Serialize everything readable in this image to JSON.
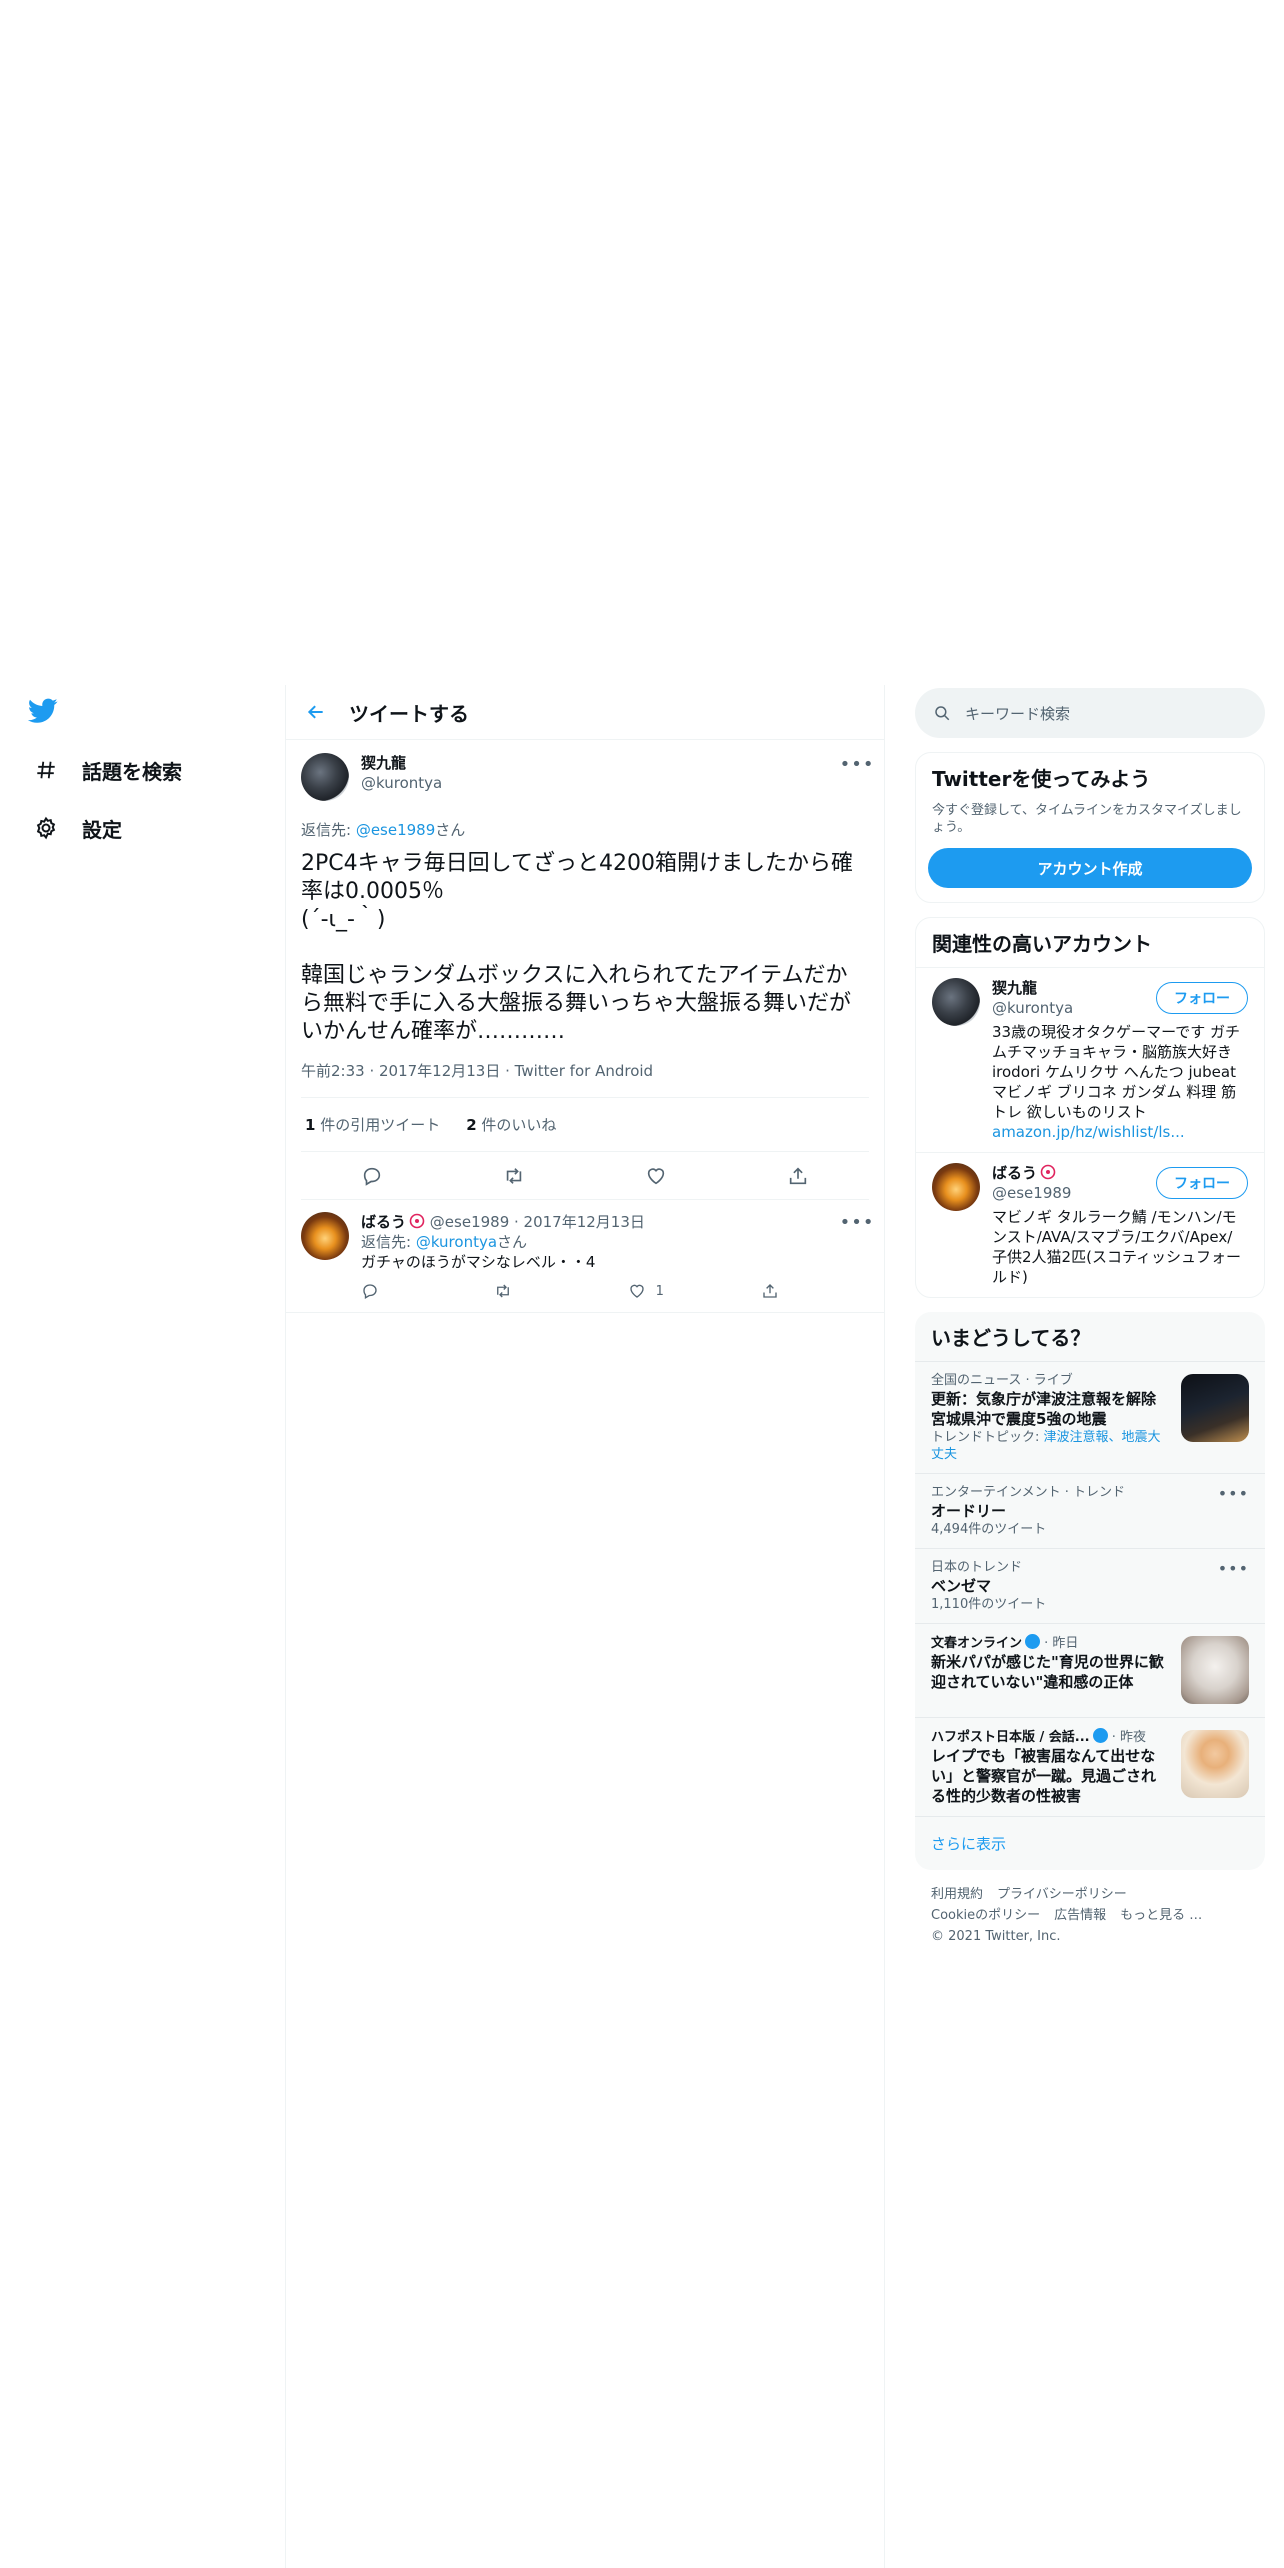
{
  "nav": {
    "items": [
      {
        "label": "話題を検索",
        "icon": "hashtag-icon"
      },
      {
        "label": "設定",
        "icon": "gear-icon"
      }
    ]
  },
  "header": {
    "title": "ツイートする"
  },
  "tweet": {
    "author_name": "猰九龍",
    "author_handle": "@kurontya",
    "replying_prefix": "返信先: ",
    "replying_handle": "@ese1989",
    "replying_suffix": "さん",
    "text": "2PC4キャラ毎日回してざっと4200箱開けましたから確率は0.0005％\n(´-ι_-｀)\n\n韓国じゃランダムボックスに入れられてたアイテムだから無料で手に入る大盤振る舞いっちゃ大盤振る舞いだがいかんせん確率が…………",
    "meta": "午前2:33 · 2017年12月13日 · Twitter for Android",
    "quote_count": "1",
    "quote_label": " 件の引用ツイート",
    "like_count": "2",
    "like_label": " 件のいいね"
  },
  "reply": {
    "name": "ばるう",
    "handle_date": "@ese1989 · 2017年12月13日",
    "replying_prefix": "返信先: ",
    "replying_handle": "@kurontya",
    "replying_suffix": "さん",
    "text": "ガチャのほうがマシなレベル・・4",
    "like_count": "1"
  },
  "search": {
    "placeholder": "キーワード検索"
  },
  "signup": {
    "title": "Twitterを使ってみよう",
    "subtitle": "今すぐ登録して、タイムラインをカスタマイズしましょう。",
    "button": "アカウント作成"
  },
  "related": {
    "title": "関連性の高いアカウント",
    "accounts": [
      {
        "name": "猰九龍",
        "handle": "@kurontya",
        "bio": "33歳の現役オタクゲーマーです ガチムチマッチョキャラ・脳筋族大好き irodori ケムリクサ へんたつ jubeat マビノギ ブリコネ ガンダム 料理 筋トレ 欲しいものリスト",
        "link": "amazon.jp/hz/wishlist/ls...",
        "follow": "フォロー"
      },
      {
        "name": "ばるう",
        "handle": "@ese1989",
        "bio": "マビノギ タルラーク鯖 /モンハン/モンスト/AVA/スマブラ/エクバ/Apex/ 子供2人猫2匹(スコティッシュフォールド)",
        "follow": "フォロー"
      }
    ]
  },
  "trends": {
    "title": "いまどうしてる？",
    "items": [
      {
        "category": "全国のニュース · ライブ",
        "title": "更新：気象庁が津波注意報を解除　宮城県沖で震度5強の地震",
        "sub_prefix": "トレンドトピック: ",
        "sub_link": "津波注意報、地震大丈夫"
      },
      {
        "category": "エンターテインメント · トレンド",
        "title": "オードリー",
        "sub": "4,494件のツイート"
      },
      {
        "category": "日本のトレンド",
        "title": "ベンゼマ",
        "sub": "1,110件のツイート"
      },
      {
        "source": "文春オンライン",
        "time": " · 昨日",
        "title": "新米パパが感じた\"育児の世界に歓迎されていない\"違和感の正体"
      },
      {
        "source": "ハフポスト日本版 / 会話...",
        "time": " · 昨夜",
        "title": "レイプでも「被害届なんて出せない」と警察官が一蹴。見過ごされる性的少数者の性被害"
      }
    ],
    "show_more": "さらに表示"
  },
  "footer": {
    "links": [
      "利用規約",
      "プライバシーポリシー",
      "Cookieのポリシー",
      "広告情報",
      "もっと見る …"
    ],
    "copyright": "© 2021 Twitter, Inc."
  },
  "colors": {
    "accent": "#1d9bf0",
    "text": "#0f1419",
    "muted": "#536471"
  }
}
